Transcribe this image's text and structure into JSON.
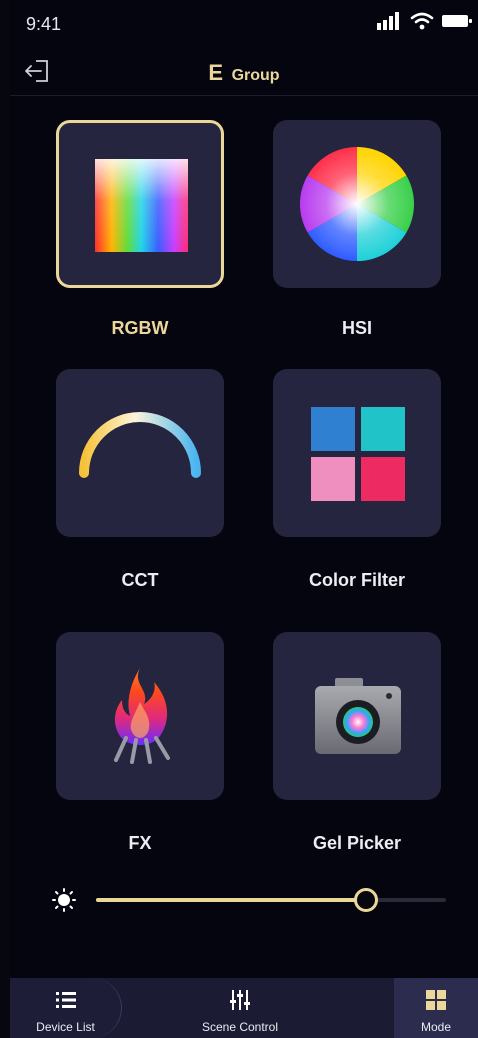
{
  "status_bar": {
    "time": "9:41"
  },
  "header": {
    "letter": "E",
    "title": "Group"
  },
  "modes": [
    {
      "label": "RGBW",
      "icon": "rgbw-spectrum-icon",
      "selected": true
    },
    {
      "label": "HSI",
      "icon": "color-wheel-icon",
      "selected": false
    },
    {
      "label": "CCT",
      "icon": "cct-arc-icon",
      "selected": false
    },
    {
      "label": "Color Filter",
      "icon": "color-filter-swatches-icon",
      "selected": false
    },
    {
      "label": "FX",
      "icon": "fire-icon",
      "selected": false
    },
    {
      "label": "Gel Picker",
      "icon": "camera-icon",
      "selected": false
    }
  ],
  "brightness": {
    "level": 0.77
  },
  "tab_bar": {
    "items": [
      {
        "label": "Device List",
        "icon": "list-icon"
      },
      {
        "label": "Scene Control",
        "icon": "sliders-icon"
      },
      {
        "label": "Mode",
        "icon": "grid-icon",
        "active": true
      }
    ]
  },
  "colors": {
    "accent": "#ecd79a",
    "tile": "#25253f",
    "background": "#050510"
  }
}
